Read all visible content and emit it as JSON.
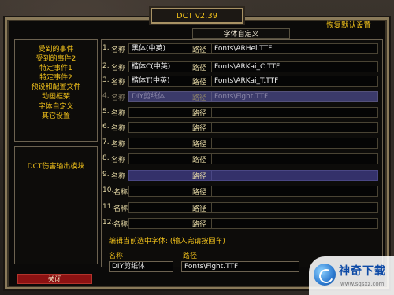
{
  "window": {
    "title": "DCT v2.39",
    "restore_defaults": "恢复默认设置"
  },
  "sidebar": {
    "items": [
      {
        "label": "受到的事件"
      },
      {
        "label": "受到的事件2"
      },
      {
        "label": "特定事件1"
      },
      {
        "label": "特定事件2"
      },
      {
        "label": "预设和配置文件"
      },
      {
        "label": "动画框架"
      },
      {
        "label": "字体自定义"
      },
      {
        "label": "其它设置"
      }
    ],
    "module_label": "DCT伤害输出模块",
    "close_label": "关闭"
  },
  "main": {
    "section_title": "字体自定义",
    "name_label": "名称",
    "path_label": "路径",
    "rows": [
      {
        "num": "1.",
        "name": "黑体(中英)",
        "path": "Fonts\\ARHei.TTF"
      },
      {
        "num": "2.",
        "name": "楷体C(中英)",
        "path": "Fonts\\ARKai_C.TTF"
      },
      {
        "num": "3.",
        "name": "楷体T(中英)",
        "path": "Fonts\\ARKai_T.TTF"
      },
      {
        "num": "4.",
        "name": "DIY剪纸体",
        "path": "Fonts\\Fight.TTF"
      },
      {
        "num": "5.",
        "name": "",
        "path": ""
      },
      {
        "num": "6.",
        "name": "",
        "path": ""
      },
      {
        "num": "7.",
        "name": "",
        "path": ""
      },
      {
        "num": "8.",
        "name": "",
        "path": ""
      },
      {
        "num": "9.",
        "name": "",
        "path": ""
      },
      {
        "num": "10.",
        "name": "",
        "path": ""
      },
      {
        "num": "11.",
        "name": "",
        "path": ""
      },
      {
        "num": "12.",
        "name": "",
        "path": ""
      }
    ],
    "edit": {
      "title": "编辑当前选中字体: (输入完请按回车)",
      "name_label": "名称",
      "path_label": "路径",
      "name_value": "DIY剪纸体",
      "path_value": "Fonts\\Fight.TTF"
    }
  },
  "watermark": {
    "text": "神奇下载",
    "url": "www.sqsxz.com"
  }
}
